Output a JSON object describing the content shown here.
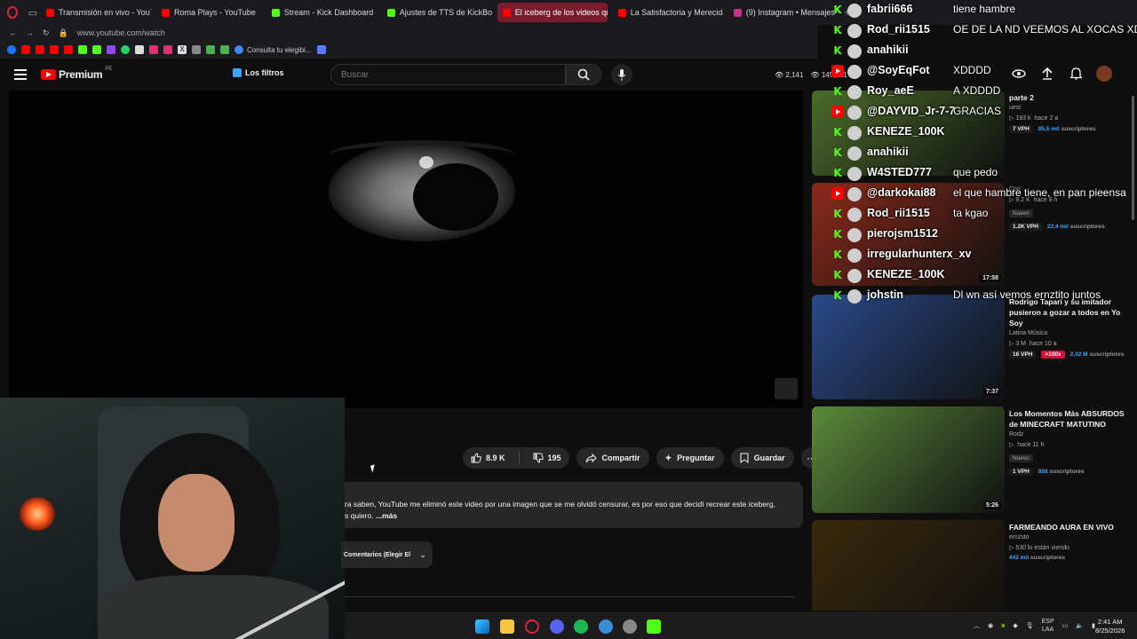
{
  "browser": {
    "tabs": [
      {
        "label": "Transmisión en vivo - YouT",
        "color": "#ff0000",
        "active": false
      },
      {
        "label": "Roma Plays - YouTube",
        "color": "#ff0000",
        "active": false
      },
      {
        "label": "Stream - Kick Dashboard",
        "color": "#53fc18",
        "active": false
      },
      {
        "label": "Ajustes de TTS de KickBot",
        "color": "#53fc18",
        "active": false
      },
      {
        "label": "El iceberg de los videos qu",
        "color": "#ff0000",
        "active": true
      },
      {
        "label": "La Satisfactoria y Merecida",
        "color": "#ff0000",
        "active": false
      },
      {
        "label": "(9) Instagram • Mensajes",
        "color": "#c13584",
        "active": false
      }
    ],
    "url": "www.youtube.com/watch",
    "bookmark_text": "Consulta tu elegibi..."
  },
  "youtube": {
    "logo": "Premium",
    "region": "PE",
    "filters_label": "Los filtros",
    "search_placeholder": "Buscar",
    "stat1": "2,141",
    "stat2": "145,321"
  },
  "actions": {
    "likes": "8.9 K",
    "dislikes": "195",
    "share": "Compartir",
    "ask": "Preguntar",
    "save": "Guardar"
  },
  "description": {
    "line1": "ra saben, YouTube me eliminó este video por una imagen que se me olvidó censurar, es por eso que decidí recrear este iceberg,",
    "line2": "s quiero.",
    "more": "...más"
  },
  "comments_label": "Comentarios (Elegir El",
  "recommendations": [
    {
      "title": "parte 2",
      "channel": "uest",
      "views": "193 k",
      "age": "hace 2 a",
      "vph": "7 VPH",
      "subs": "85,5 mil",
      "subs_suffix": "suscriptores",
      "duration": "",
      "nuevo": "",
      "x100": "",
      "thumb": "#4b6b2a"
    },
    {
      "title": "",
      "channel": "Cori",
      "views": "9.2 K",
      "age": "hace 8 h",
      "vph": "1.2K VPH",
      "subs": "23,4 mil",
      "subs_suffix": "suscriptores",
      "duration": "17:58",
      "nuevo": "Nuevo",
      "x100": "",
      "thumb": "#8a2a1a"
    },
    {
      "title": "Rodrigo Tapari y su imitador pusieron a gozar a todos en Yo Soy",
      "channel": "Latina Música",
      "views": "3 M",
      "age": "hace 10 a",
      "vph": "16 VPH",
      "subs": "2,42 M",
      "subs_suffix": "suscriptores",
      "duration": "7:37",
      "nuevo": "",
      "x100": ">100x",
      "thumb": "#2a4a8a"
    },
    {
      "title": "Los Momentos Más ABSURDOS de MINECRAFT MATUTINO",
      "channel": "Rodz",
      "views": "",
      "age": "hace 11 h",
      "vph": "1 VPH",
      "subs": "858",
      "subs_suffix": "suscriptores",
      "duration": "5:26",
      "nuevo": "Nuevo",
      "x100": "",
      "thumb": "#5a8a3a"
    },
    {
      "title": "FARMEANDO AURA EN VIVO",
      "channel": "emzsto",
      "views": "530 lo están viendo",
      "age": "",
      "vph": "",
      "subs": "442 mil",
      "subs_suffix": "suscriptores",
      "duration": "",
      "nuevo": "",
      "x100": "",
      "thumb": "#3a2a0a"
    }
  ],
  "chat": [
    {
      "platform": "kick",
      "user": "fabrii666",
      "text": "tiene hambre"
    },
    {
      "platform": "kick",
      "user": "Rod_rii1515",
      "text": "OE DE LA ND VEEMOS AL XOCAS XD"
    },
    {
      "platform": "kick",
      "user": "anahikii",
      "text": ""
    },
    {
      "platform": "youtube",
      "user": "@SoyEqFot",
      "text": "XDDDD"
    },
    {
      "platform": "kick",
      "user": "Roy_aeE",
      "text": "A XDDDD"
    },
    {
      "platform": "youtube",
      "user": "@DAYVID_Jr-7-7",
      "text": "GRACIAS"
    },
    {
      "platform": "kick",
      "user": "KENEZE_100K",
      "text": ""
    },
    {
      "platform": "kick",
      "user": "anahikii",
      "text": ""
    },
    {
      "platform": "kick",
      "user": "W4STED777",
      "text": "que pedo"
    },
    {
      "platform": "youtube",
      "user": "@darkokai88",
      "text": "el que hambre tiene, en pan pieensa"
    },
    {
      "platform": "kick",
      "user": "Rod_rii1515",
      "text": "ta kgao"
    },
    {
      "platform": "kick",
      "user": "pierojsm1512",
      "text": ""
    },
    {
      "platform": "kick",
      "user": "irregularhunterx_xv",
      "text": ""
    },
    {
      "platform": "kick",
      "user": "KENEZE_100K",
      "text": ""
    },
    {
      "platform": "kick",
      "user": "johstin",
      "text": "Dl wn así vemos ernztito juntos"
    }
  ],
  "taskbar": {
    "lang1": "ESP",
    "lang2": "LAA",
    "time": "2:41 AM",
    "date": "8/25/2026"
  }
}
